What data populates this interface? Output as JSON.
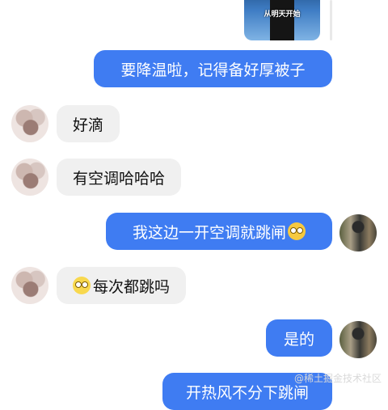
{
  "shared_media": {
    "caption": "从明天开始"
  },
  "messages": [
    {
      "side": "out",
      "text": "要降温啦，记得备好厚被子"
    },
    {
      "side": "in",
      "text": "好滴"
    },
    {
      "side": "in",
      "text": "有空调哈哈哈"
    },
    {
      "side": "out",
      "text": "我这边一开空调就跳闸",
      "emoji": "rofl-face-icon"
    },
    {
      "side": "in",
      "text": "每次都跳吗",
      "emoji": "rolling-eyes-face-icon"
    },
    {
      "side": "out",
      "text": "是的"
    },
    {
      "side": "out",
      "text": "开热风不分下跳闸"
    }
  ],
  "watermark": "@稀土掘金技术社区"
}
